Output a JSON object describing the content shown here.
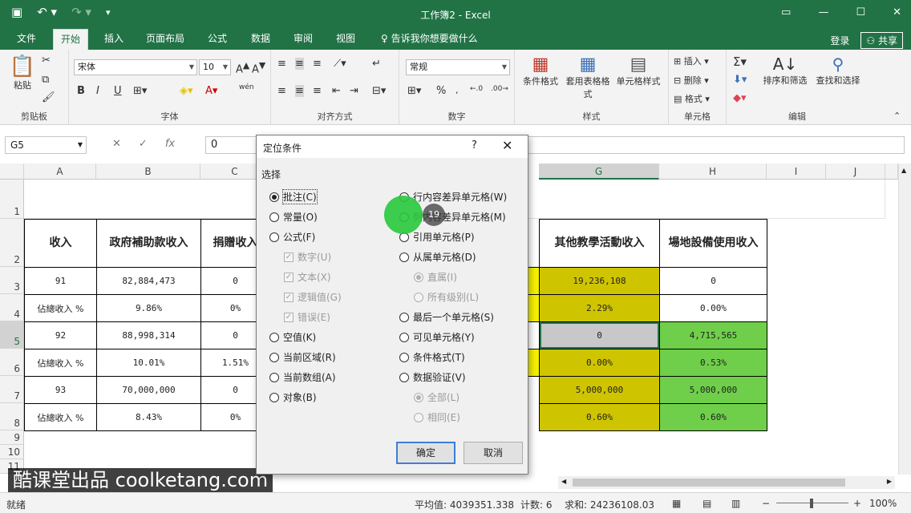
{
  "window": {
    "title": "工作簿2 - Excel"
  },
  "tabs": [
    {
      "label": "文件"
    },
    {
      "label": "开始"
    },
    {
      "label": "插入"
    },
    {
      "label": "页面布局"
    },
    {
      "label": "公式"
    },
    {
      "label": "数据"
    },
    {
      "label": "审阅"
    },
    {
      "label": "视图"
    }
  ],
  "tellme": "告诉我你想要做什么",
  "signin": "登录",
  "share": "共享",
  "ribbon": {
    "clipboard": {
      "paste": "粘贴",
      "group": "剪贴板"
    },
    "font": {
      "name": "宋体",
      "size": "10",
      "group": "字体",
      "bold": "B",
      "italic": "I",
      "underline": "U",
      "wen": "wén"
    },
    "alignment": {
      "group": "对齐方式"
    },
    "number": {
      "format": "常规",
      "group": "数字"
    },
    "styles": {
      "cond": "条件格式",
      "table": "套用表格格式",
      "cell": "单元格样式",
      "group": "样式"
    },
    "cells": {
      "insert": "插入",
      "delete": "删除",
      "format": "格式",
      "group": "单元格"
    },
    "editing": {
      "sort": "排序和筛选",
      "find": "查找和选择",
      "group": "编辑"
    }
  },
  "formula": {
    "namebox": "G5",
    "value": "0",
    "fx": "fx"
  },
  "columns": [
    "A",
    "B",
    "C",
    "G",
    "H",
    "I",
    "J"
  ],
  "rows": [
    "1",
    "2",
    "3",
    "4",
    "5",
    "6",
    "7",
    "8",
    "9",
    "10",
    "11"
  ],
  "sheet": {
    "headers": {
      "a": "收入",
      "b": "政府補助款收入",
      "c": "捐贈收入",
      "g": "其他教學活動收入",
      "h": "場地設備使用收入"
    },
    "data": [
      {
        "a": "91",
        "b": "82,884,473",
        "c": "0",
        "g": "19,236,108",
        "h": "0"
      },
      {
        "a": "佔總收入 %",
        "b": "9.86%",
        "c": "0%",
        "g": "2.29%",
        "h": "0.00%"
      },
      {
        "a": "92",
        "b": "88,998,314",
        "c": "0",
        "g": "0",
        "h": "4,715,565"
      },
      {
        "a": "佔總收入 %",
        "b": "10.01%",
        "c": "1.51%",
        "g": "0.00%",
        "h": "0.53%"
      },
      {
        "a": "93",
        "b": "70,000,000",
        "c": "0",
        "g": "5,000,000",
        "h": "5,000,000"
      },
      {
        "a": "佔總收入 %",
        "b": "8.43%",
        "c": "0%",
        "g": "0.60%",
        "h": "0.60%"
      }
    ]
  },
  "dialog": {
    "title": "定位条件",
    "help": "?",
    "section": "选择",
    "left": [
      {
        "label": "批注(C)",
        "checked": true
      },
      {
        "label": "常量(O)"
      },
      {
        "label": "公式(F)"
      },
      {
        "label": "数字(U)"
      },
      {
        "label": "文本(X)"
      },
      {
        "label": "逻辑值(G)"
      },
      {
        "label": "错误(E)"
      },
      {
        "label": "空值(K)"
      },
      {
        "label": "当前区域(R)"
      },
      {
        "label": "当前数组(A)"
      },
      {
        "label": "对象(B)"
      }
    ],
    "right": [
      {
        "label": "行内容差异单元格(W)"
      },
      {
        "label": "列内容差异单元格(M)"
      },
      {
        "label": "引用单元格(P)"
      },
      {
        "label": "从属单元格(D)"
      },
      {
        "label": "直属(I)"
      },
      {
        "label": "所有级别(L)"
      },
      {
        "label": "最后一个单元格(S)"
      },
      {
        "label": "可见单元格(Y)"
      },
      {
        "label": "条件格式(T)"
      },
      {
        "label": "数据验证(V)"
      },
      {
        "label": "全部(L)"
      },
      {
        "label": "相同(E)"
      }
    ],
    "ok": "确定",
    "cancel": "取消"
  },
  "cursor_badge": "19",
  "status": {
    "ready": "就绪",
    "avg": "平均值: 4039351.338",
    "count": "计数: 6",
    "sum": "求和: 24236108.03",
    "zoom": "100%"
  },
  "watermark": "酷课堂出品 coolketang.com"
}
